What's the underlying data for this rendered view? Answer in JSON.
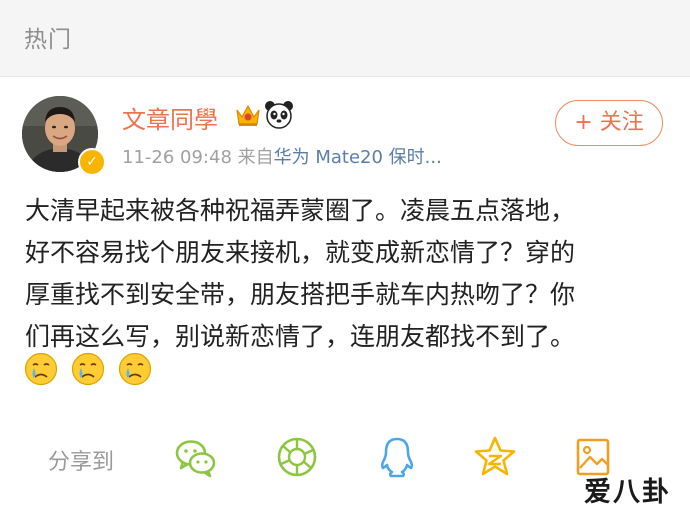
{
  "header": {
    "title": "热门"
  },
  "post": {
    "author": {
      "name": "文章同學",
      "verified": true
    },
    "meta": {
      "time": "11-26 09:48",
      "from_label": "来自",
      "source": "华为 Mate20 保时..."
    },
    "follow_label": "+ 关注",
    "text_lines": [
      "大清早起来被各种祝福弄蒙圈了。凌晨五点落地，",
      "好不容易找个朋友来接机，就变成新恋情了？穿的",
      "厚重找不到安全带，朋友搭把手就车内热吻了？你",
      "们再这么写，别说新恋情了，连朋友都找不到了。"
    ],
    "emojis": [
      "crying-face",
      "crying-face",
      "crying-face"
    ]
  },
  "share": {
    "label": "分享到",
    "targets": [
      "wechat",
      "moments",
      "qq",
      "qzone",
      "save-image"
    ]
  },
  "watermark": "爱八卦",
  "colors": {
    "brand_orange": "#eb7350",
    "link_blue": "#5b7ea8",
    "icon_green": "#8cc63f",
    "icon_blue": "#4da6e8",
    "icon_yellow": "#f7b500",
    "icon_orange": "#f0a020"
  }
}
